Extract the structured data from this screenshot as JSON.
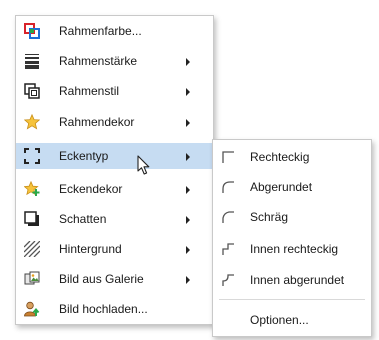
{
  "main_menu": {
    "items": [
      {
        "label": "Rahmenfarbe...",
        "icon": "border-color-icon",
        "has_submenu": false
      },
      {
        "label": "Rahmenstärke",
        "icon": "border-width-icon",
        "has_submenu": true
      },
      {
        "label": "Rahmenstil",
        "icon": "border-style-icon",
        "has_submenu": true
      },
      {
        "label": "Rahmendekor",
        "icon": "star-icon",
        "has_submenu": true
      },
      {
        "label": "Eckentyp",
        "icon": "corner-type-icon",
        "has_submenu": true,
        "highlighted": true
      },
      {
        "label": "Eckendekor",
        "icon": "star-plus-icon",
        "has_submenu": true
      },
      {
        "label": "Schatten",
        "icon": "shadow-icon",
        "has_submenu": true
      },
      {
        "label": "Hintergrund",
        "icon": "hatch-background-icon",
        "has_submenu": true
      },
      {
        "label": "Bild aus Galerie",
        "icon": "gallery-image-icon",
        "has_submenu": true
      },
      {
        "label": "Bild hochladen...",
        "icon": "upload-image-icon",
        "has_submenu": false
      }
    ]
  },
  "corner_submenu": {
    "items": [
      {
        "label": "Rechteckig",
        "icon": "corner-square-icon"
      },
      {
        "label": "Abgerundet",
        "icon": "corner-rounded-icon"
      },
      {
        "label": "Schräg",
        "icon": "corner-bevel-icon"
      },
      {
        "label": "Innen rechteckig",
        "icon": "corner-inner-square-icon"
      },
      {
        "label": "Innen abgerundet",
        "icon": "corner-inner-rounded-icon"
      }
    ],
    "options_label": "Optionen..."
  },
  "colors": {
    "highlight": "#c6dcf2",
    "border": "#c9c9c9"
  }
}
